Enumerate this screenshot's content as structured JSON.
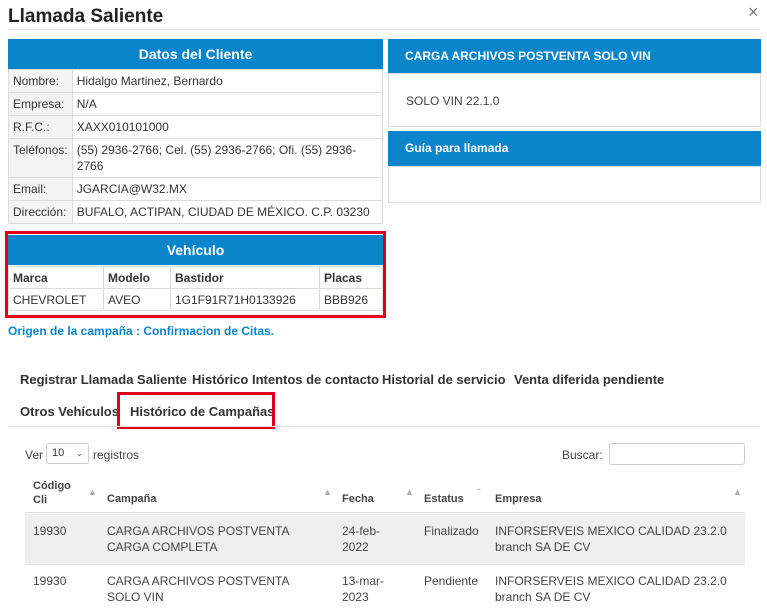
{
  "dialog": {
    "title": "Llamada Saliente",
    "close": "×"
  },
  "cliente": {
    "header": "Datos del Cliente",
    "rows": [
      {
        "label": "Nombre:",
        "value": "Hidalgo Martinez, Bernardo"
      },
      {
        "label": "Empresa:",
        "value": "N/A"
      },
      {
        "label": "R.F.C.:",
        "value": "XAXX010101000"
      },
      {
        "label": "Teléfonos:",
        "value": "(55) 2936-2766; Cel. (55) 2936-2766; Ofi. (55) 2936-2766"
      },
      {
        "label": "Email:",
        "value": "JGARCIA@W32.MX"
      },
      {
        "label": "Dirección:",
        "value": "BUFALO, ACTIPAN, CIUDAD DE MÉXICO. C.P. 03230"
      }
    ]
  },
  "vehiculo": {
    "header": "Vehículo",
    "columns": [
      "Marca",
      "Modelo",
      "Bastidor",
      "Placas"
    ],
    "row": [
      "CHEVROLET",
      "AVEO",
      "1G1F91R71H0133926",
      "BBB926"
    ]
  },
  "carga": {
    "header": "CARGA ARCHIVOS POSTVENTA SOLO VIN",
    "body": "SOLO VIN 22.1.0"
  },
  "guia": {
    "header": "Guía para llamada"
  },
  "origen": "Origen de la campaña : Confirmacion de Citas.",
  "tabs": [
    "Registrar Llamada Saliente",
    "Histórico Intentos de contacto",
    "Historial de servicio",
    "Venta diferida pendiente",
    "Otros Vehículos",
    "Histórico de Campañas"
  ],
  "datatable": {
    "ver": "Ver",
    "per_page": "10",
    "registros": "registros",
    "buscar": "Buscar:",
    "columns": [
      "Código Cli",
      "Campaña",
      "Fecha",
      "Estatus",
      "Empresa"
    ],
    "rows": [
      [
        "19930",
        "CARGA ARCHIVOS POSTVENTA CARGA COMPLETA",
        "24-feb-2022",
        "Finalizado",
        "INFORSERVEIS MEXICO CALIDAD 23.2.0 branch SA DE CV"
      ],
      [
        "19930",
        "CARGA ARCHIVOS POSTVENTA SOLO VIN",
        "13-mar-2023",
        "Pendiente",
        "INFORSERVEIS MEXICO CALIDAD 23.2.0 branch SA DE CV"
      ]
    ]
  },
  "colors": {
    "accent": "#0a85cc",
    "highlight": "#e0001b"
  }
}
